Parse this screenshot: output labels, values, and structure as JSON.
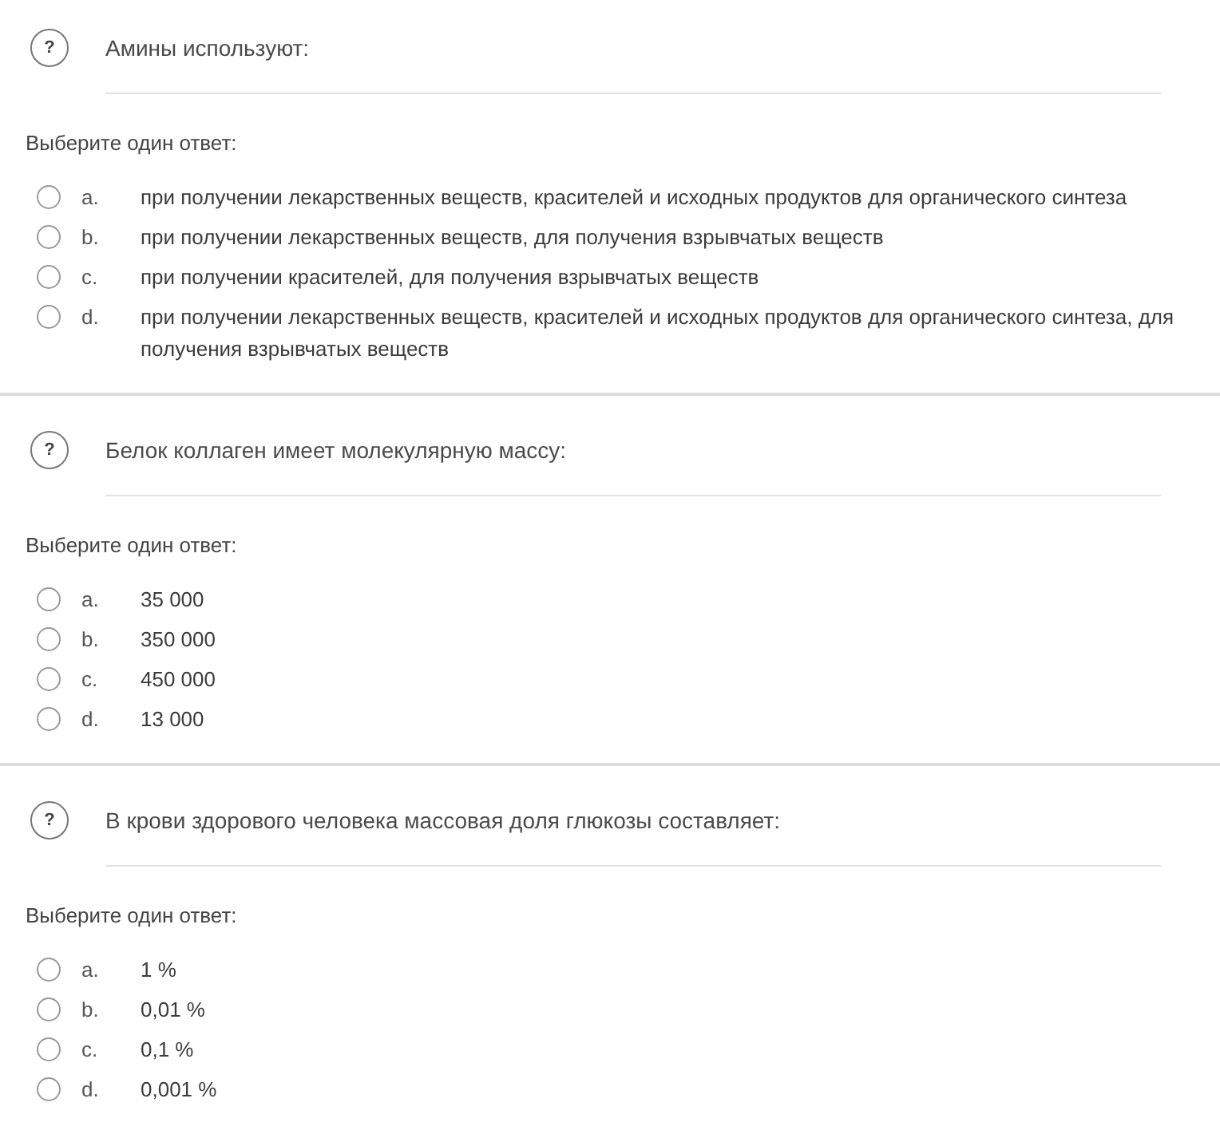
{
  "questions": [
    {
      "icon": "?",
      "text": "Амины используют:",
      "prompt": "Выберите один ответ:",
      "options": [
        {
          "letter": "a.",
          "text": "при получении лекарственных веществ, красителей и исходных продуктов для органического синтеза",
          "selected": false
        },
        {
          "letter": "b.",
          "text": "при получении лекарственных веществ, для получения взрывчатых веществ",
          "selected": false
        },
        {
          "letter": "c.",
          "text": "при получении красителей, для получения взрывчатых веществ",
          "selected": false
        },
        {
          "letter": "d.",
          "text": "при получении лекарственных веществ, красителей и исходных продуктов для органического синтеза, для получения взрывчатых веществ",
          "selected": false
        }
      ]
    },
    {
      "icon": "?",
      "text": "Белок коллаген имеет молекулярную массу:",
      "prompt": "Выберите один ответ:",
      "options": [
        {
          "letter": "a.",
          "text": "35 000",
          "selected": false
        },
        {
          "letter": "b.",
          "text": "350 000",
          "selected": false
        },
        {
          "letter": "c.",
          "text": "450 000",
          "selected": false
        },
        {
          "letter": "d.",
          "text": "13 000",
          "selected": false
        }
      ]
    },
    {
      "icon": "?",
      "text": "В крови здорового человека массовая доля глюкозы составляет:",
      "prompt": "Выберите один ответ:",
      "options": [
        {
          "letter": "a.",
          "text": "1 %",
          "selected": false
        },
        {
          "letter": "b.",
          "text": "0,01 %",
          "selected": false
        },
        {
          "letter": "c.",
          "text": "0,1 %",
          "selected": false
        },
        {
          "letter": "d.",
          "text": "0,001 %",
          "selected": false
        }
      ]
    }
  ]
}
